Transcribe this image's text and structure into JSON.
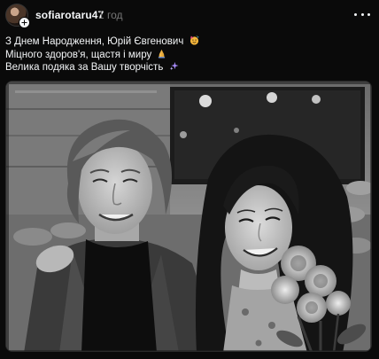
{
  "post": {
    "author": {
      "username": "sofiarotaru47",
      "avatar_icon": "avatar",
      "follow_icon": "plus-icon"
    },
    "timestamp": "1 год",
    "more_icon": "more-horizontal-icon",
    "caption": {
      "lines": [
        {
          "text": "З Днем Народження, Юрій Євгенович",
          "emoji": "party-face-emoji"
        },
        {
          "text": "Міцного здоров'я, щастя і миру",
          "emoji": "folded-hands-emoji"
        },
        {
          "text": "Велика подяка за Вашу творчість",
          "emoji": "sparkles-emoji"
        }
      ]
    },
    "media": {
      "type": "photo",
      "style": "black-and-white",
      "subject": "vintage-portrait-couple-with-flowers"
    }
  },
  "colors": {
    "background": "#0a0a0a",
    "text_primary": "#f3f5f7",
    "text_secondary": "#777777",
    "accent_purple": "#a78bfa"
  }
}
